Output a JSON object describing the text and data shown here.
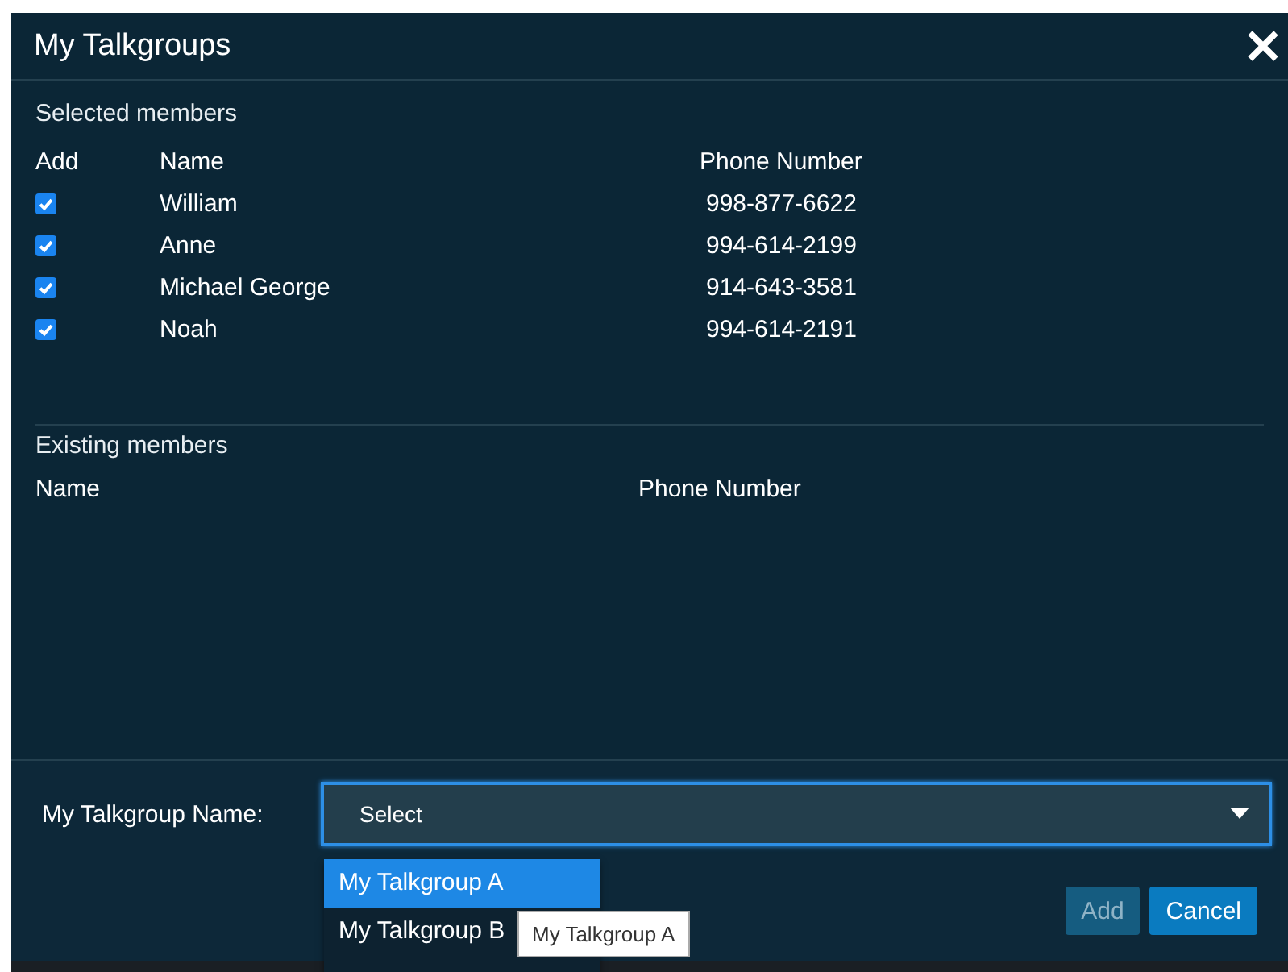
{
  "dialog": {
    "title": "My Talkgroups"
  },
  "selected_members": {
    "heading": "Selected members",
    "columns": [
      "Add",
      "Name",
      "Phone Number"
    ],
    "rows": [
      {
        "checked": true,
        "name": "William",
        "phone": "998-877-6622"
      },
      {
        "checked": true,
        "name": "Anne",
        "phone": "994-614-2199"
      },
      {
        "checked": true,
        "name": "Michael George",
        "phone": "914-643-3581"
      },
      {
        "checked": true,
        "name": "Noah",
        "phone": "994-614-2191"
      }
    ]
  },
  "existing_members": {
    "heading": "Existing members",
    "columns": [
      "Name",
      "Phone Number"
    ]
  },
  "footer": {
    "label": "My Talkgroup Name:",
    "select": {
      "value": "Select"
    },
    "options": [
      {
        "label": "My Talkgroup A",
        "selected": true
      },
      {
        "label": "My Talkgroup B",
        "selected": false
      }
    ],
    "tooltip": "My Talkgroup A",
    "buttons": [
      {
        "label": "Add",
        "disabled": true
      },
      {
        "label": "Cancel",
        "disabled": false
      }
    ]
  }
}
